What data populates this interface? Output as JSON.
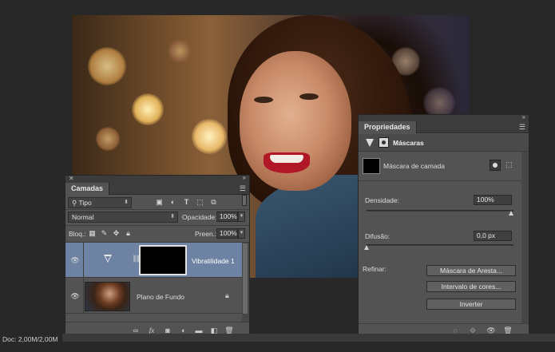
{
  "layers_panel": {
    "tab": "Camadas",
    "filter": {
      "value": "Tipo",
      "search_icon": "search-icon"
    },
    "filter_icons": [
      "image-filter-icon",
      "adjustment-filter-icon",
      "type-filter-icon",
      "shape-filter-icon",
      "smart-object-filter-icon"
    ],
    "blend_mode": "Normal",
    "opacity": {
      "label": "Opacidade:",
      "value": "100%"
    },
    "lock": {
      "label": "Bloq.:",
      "icons": [
        "lock-transparent-icon",
        "lock-brush-icon",
        "lock-move-icon",
        "lock-all-icon"
      ]
    },
    "fill": {
      "label": "Preen.:",
      "value": "100%"
    },
    "layers": [
      {
        "name": "Vibratilidade 1",
        "type": "adjustment",
        "selected": true,
        "visible": true
      },
      {
        "name": "Plano de Fundo",
        "type": "background",
        "selected": false,
        "visible": true,
        "locked": true
      }
    ],
    "footer_icons": [
      "link-icon",
      "fx-icon",
      "mask-icon",
      "adjustment-icon",
      "folder-icon",
      "new-layer-icon",
      "trash-icon"
    ]
  },
  "properties_panel": {
    "tab": "Propriedades",
    "header": "Máscaras",
    "mask_label": "Máscara de camada",
    "density": {
      "label": "Densidade:",
      "value": "100%",
      "fraction": 1.0
    },
    "feather": {
      "label": "Difusão:",
      "value": "0,0 px",
      "fraction": 0.0
    },
    "refine_label": "Refinar:",
    "buttons": {
      "edge": "Máscara de Aresta...",
      "color_range": "Intervalo de cores...",
      "invert": "Inverter"
    },
    "footer_icons": [
      "load-selection-icon",
      "apply-mask-icon",
      "visibility-icon",
      "trash-icon"
    ]
  },
  "status": {
    "doc": "Doc: 2,00M/2,00M"
  },
  "colors": {
    "selected_layer": "#6e83a3",
    "panel_bg": "#535353",
    "workspace": "#282828"
  }
}
